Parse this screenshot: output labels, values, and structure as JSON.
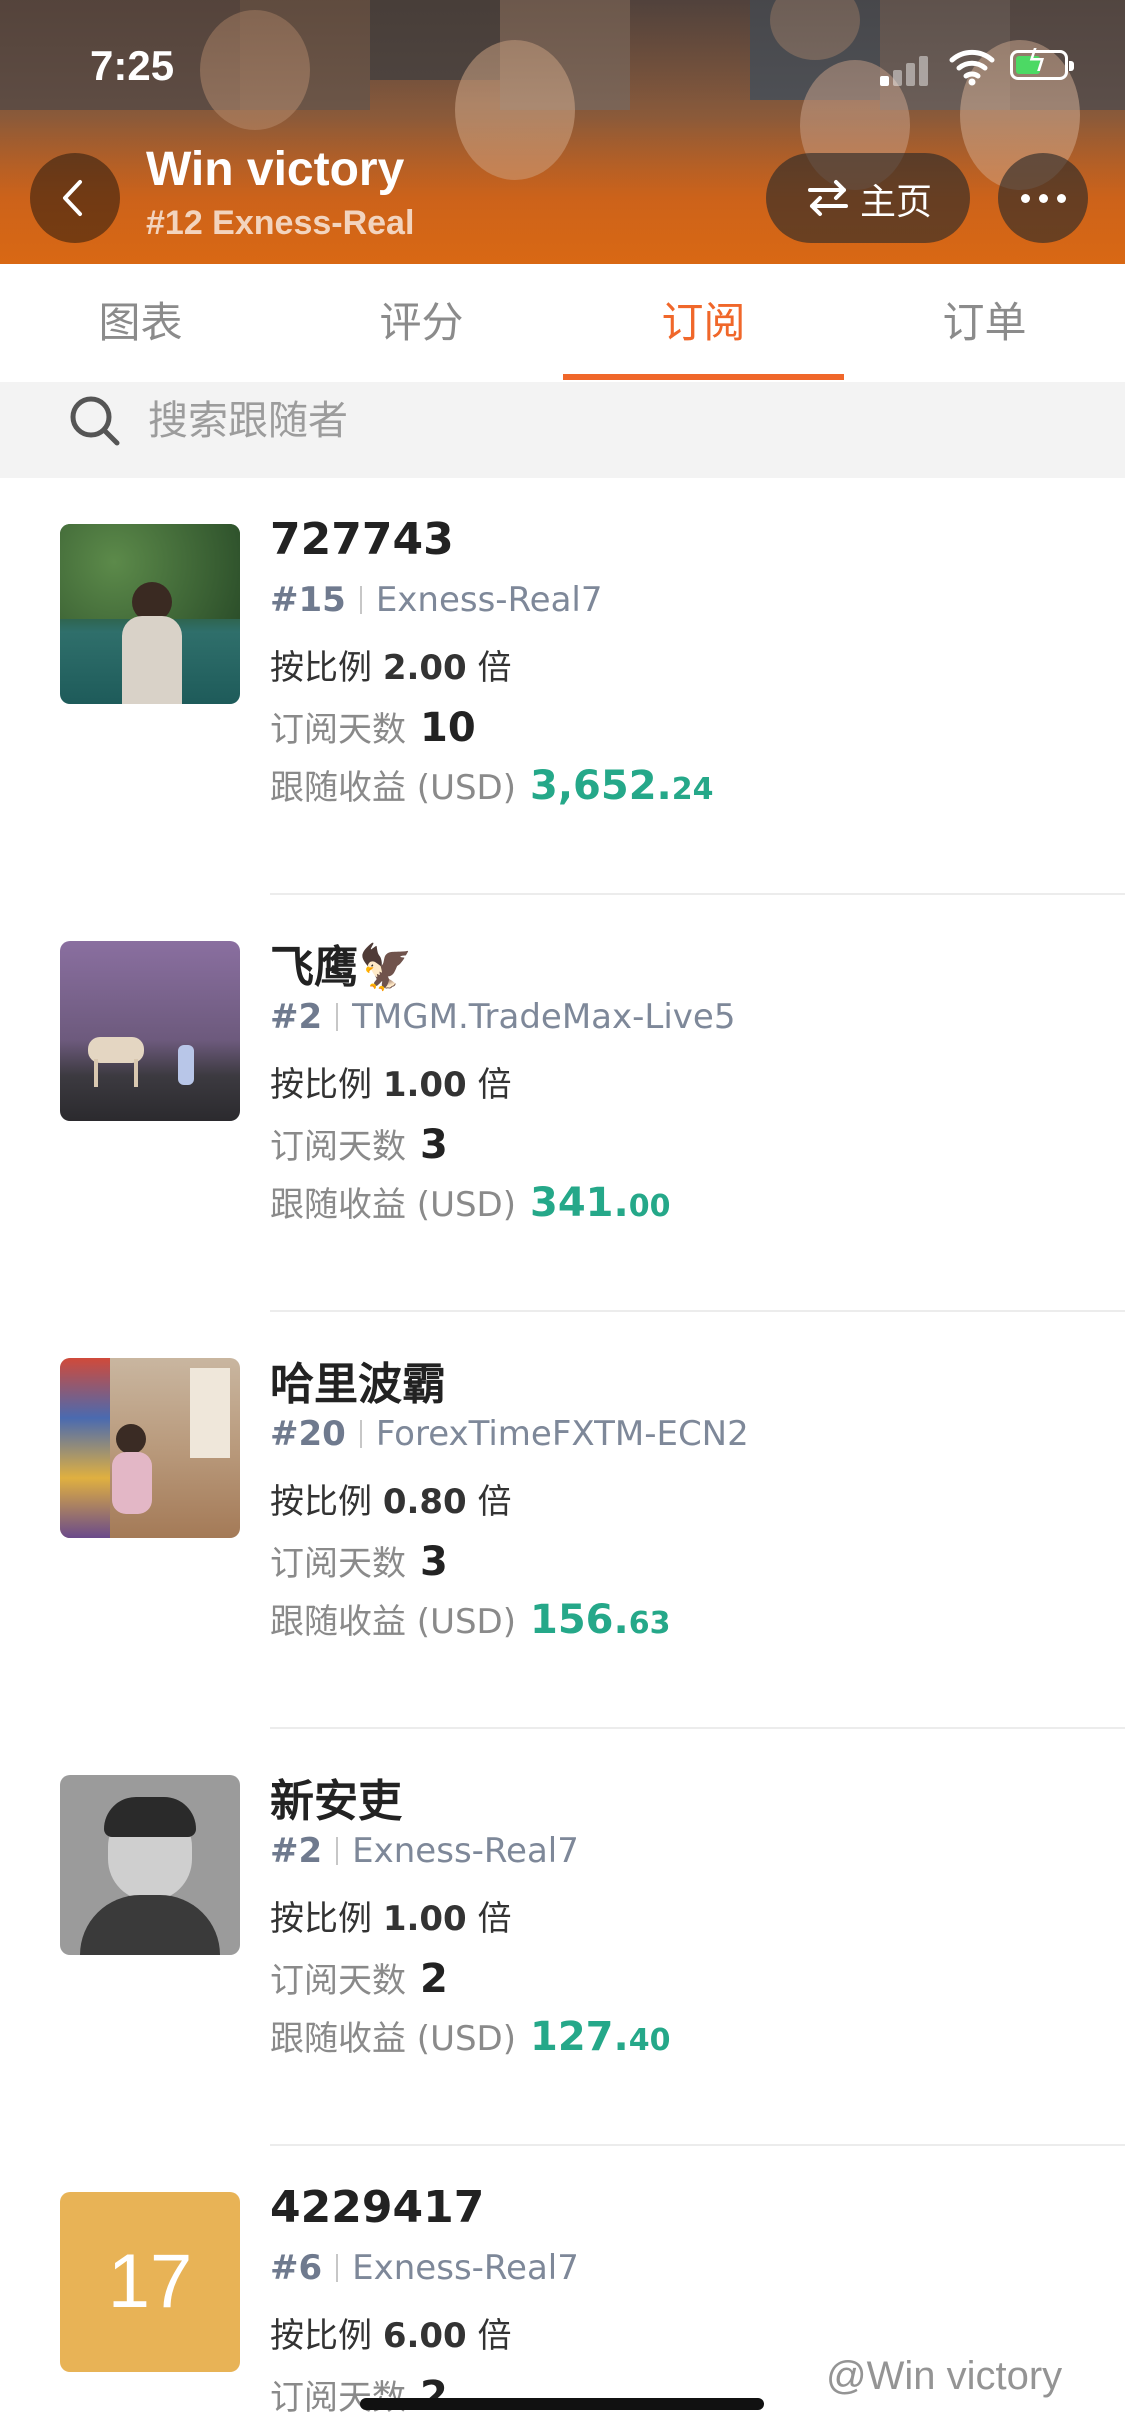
{
  "status_bar": {
    "time": "7:25"
  },
  "header": {
    "title": "Win victory",
    "subtitle": "#12 Exness-Real",
    "home_label": "主页",
    "icons": [
      "chevron-left-icon",
      "swap-arrows-icon",
      "more-dots-icon",
      "signal-icon",
      "wifi-icon",
      "battery-charging-icon"
    ]
  },
  "tabs": [
    {
      "label": "图表",
      "active": false
    },
    {
      "label": "评分",
      "active": false
    },
    {
      "label": "订阅",
      "active": true
    },
    {
      "label": "订单",
      "active": false
    }
  ],
  "search": {
    "placeholder": "搜索跟随者",
    "value": ""
  },
  "labels": {
    "ratio_prefix": "按比例",
    "ratio_suffix": "倍",
    "days": "订阅天数",
    "profit": "跟随收益 (USD)"
  },
  "subscribers": [
    {
      "name": "727743",
      "rank": "#15",
      "server": "Exness-Real7",
      "ratio": "2.00",
      "days": "10",
      "profit_int": "3,652.",
      "profit_dec": "24",
      "avatar": "photo-person-lake"
    },
    {
      "name": "飞鹰🦅",
      "rank": "#2",
      "server": "TMGM.TradeMax-Live5",
      "ratio": "1.00",
      "days": "3",
      "profit_int": "341.",
      "profit_dec": "00",
      "avatar": "photo-horse-purple-sky"
    },
    {
      "name": "哈里波霸",
      "rank": "#20",
      "server": "ForexTimeFXTM-ECN2",
      "ratio": "0.80",
      "days": "3",
      "profit_int": "156.",
      "profit_dec": "63",
      "avatar": "photo-child-room"
    },
    {
      "name": "新安吏",
      "rank": "#2",
      "server": "Exness-Real7",
      "ratio": "1.00",
      "days": "2",
      "profit_int": "127.",
      "profit_dec": "40",
      "avatar": "photo-ink-portrait"
    },
    {
      "name": "4229417",
      "rank": "#6",
      "server": "Exness-Real7",
      "ratio": "6.00",
      "days": "2",
      "profit_int": "",
      "profit_dec": "",
      "avatar_text": "17",
      "avatar": "text-avatar"
    }
  ],
  "watermark": "@Win victory",
  "colors": {
    "accent": "#f0672a",
    "profit": "#25a889",
    "header": "#d76a14"
  }
}
